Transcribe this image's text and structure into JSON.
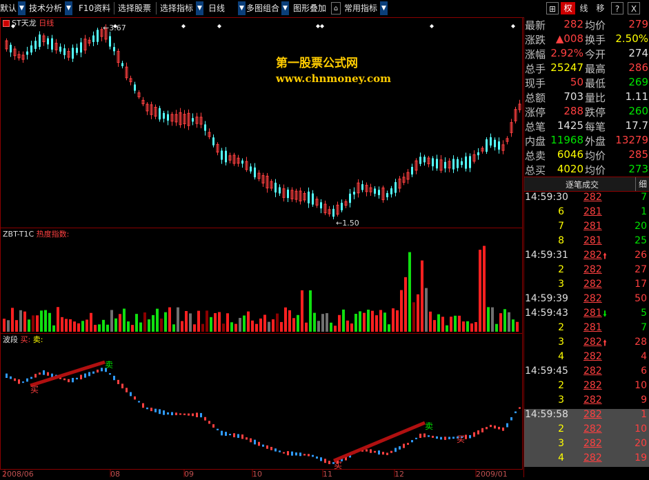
{
  "toolbar": {
    "items": [
      {
        "label": "默认",
        "dropdown": true
      },
      {
        "label": "技术分析",
        "dropdown": true
      },
      {
        "label": "F10资料",
        "dropdown": false
      },
      {
        "label": "选择股票",
        "dropdown": false
      },
      {
        "label": "选择指标",
        "dropdown": true
      },
      {
        "label": "日线",
        "dropdown": true
      },
      {
        "label": "多图组合",
        "dropdown": true
      },
      {
        "label": "图形叠加",
        "dropdown": false
      },
      {
        "label": "常用指标",
        "dropdown": true
      }
    ],
    "right_icon_plus": "⊞",
    "tabs": [
      "权",
      "线",
      "移",
      "?",
      "X"
    ],
    "active_tab": "权"
  },
  "main_chart": {
    "stock_name": "ST天龙",
    "period": "日线",
    "high_label": "3.67",
    "low_label": "1.50",
    "watermark_title": "第一股票公式网",
    "watermark_url": "www.chnmoney.com"
  },
  "indicator_panel": {
    "name": "ZBT-T1C",
    "label": "热度指数:"
  },
  "wave_panel": {
    "name": "波段",
    "buy": "买:",
    "sell": "卖:",
    "marker_buy": "买",
    "marker_sell": "卖"
  },
  "x_axis": {
    "labels": [
      "2008/06",
      "08",
      "09",
      "10",
      "11",
      "12",
      "2009/01"
    ]
  },
  "quote": {
    "rows": [
      {
        "l1": "最新",
        "v1": "282",
        "c1": "red",
        "l2": "均价",
        "v2": "279",
        "c2": "red"
      },
      {
        "l1": "涨跌",
        "v1": "▲008",
        "c1": "red",
        "l2": "换手",
        "v2": "2.50%",
        "c2": "yellow"
      },
      {
        "l1": "涨幅",
        "v1": "2.92%",
        "c1": "red",
        "l2": "今开",
        "v2": "274",
        "c2": "white"
      },
      {
        "l1": "总手",
        "v1": "25247",
        "c1": "yellow",
        "l2": "最高",
        "v2": "286",
        "c2": "red"
      },
      {
        "l1": "现手",
        "v1": "50",
        "c1": "red",
        "l2": "最低",
        "v2": "269",
        "c2": "green"
      },
      {
        "l1": "总额",
        "v1": "703",
        "c1": "white",
        "l2": "量比",
        "v2": "1.11",
        "c2": "white"
      },
      {
        "l1": "涨停",
        "v1": "288",
        "c1": "red",
        "l2": "跌停",
        "v2": "260",
        "c2": "green"
      },
      {
        "l1": "总笔",
        "v1": "1425",
        "c1": "white",
        "l2": "每笔",
        "v2": "17.7",
        "c2": "white"
      },
      {
        "l1": "内盘",
        "v1": "11968",
        "c1": "green",
        "l2": "外盘",
        "v2": "13279",
        "c2": "red"
      },
      {
        "l1": "总卖",
        "v1": "6046",
        "c1": "yellow",
        "l2": "均价",
        "v2": "285",
        "c2": "red"
      },
      {
        "l1": "总买",
        "v1": "4020",
        "c1": "yellow",
        "l2": "均价",
        "v2": "273",
        "c2": "green"
      }
    ],
    "ticks_title": "逐笔成交",
    "ticks_detail": "细"
  },
  "ticks": [
    {
      "time": "14:59:30",
      "price": "282",
      "arrow": "",
      "vol": "7",
      "vcolor": "green",
      "hl": false
    },
    {
      "time": "",
      "cnt": "6",
      "price": "281",
      "arrow": "",
      "vol": "1",
      "vcolor": "green",
      "hl": false
    },
    {
      "time": "",
      "cnt": "7",
      "price": "281",
      "arrow": "",
      "vol": "20",
      "vcolor": "green",
      "hl": false
    },
    {
      "time": "",
      "cnt": "8",
      "price": "281",
      "arrow": "",
      "vol": "25",
      "vcolor": "green",
      "hl": false
    },
    {
      "time": "14:59:31",
      "price": "282",
      "arrow": "up",
      "vol": "26",
      "vcolor": "red",
      "hl": false
    },
    {
      "time": "",
      "cnt": "2",
      "price": "282",
      "arrow": "",
      "vol": "27",
      "vcolor": "red",
      "hl": false
    },
    {
      "time": "",
      "cnt": "3",
      "price": "282",
      "arrow": "",
      "vol": "17",
      "vcolor": "red",
      "hl": false
    },
    {
      "time": "14:59:39",
      "price": "282",
      "arrow": "",
      "vol": "50",
      "vcolor": "red",
      "hl": false
    },
    {
      "time": "14:59:43",
      "price": "281",
      "arrow": "down",
      "vol": "5",
      "vcolor": "green",
      "hl": false
    },
    {
      "time": "",
      "cnt": "2",
      "price": "281",
      "arrow": "",
      "vol": "7",
      "vcolor": "green",
      "hl": false
    },
    {
      "time": "",
      "cnt": "3",
      "price": "282",
      "arrow": "up",
      "vol": "28",
      "vcolor": "red",
      "hl": false
    },
    {
      "time": "",
      "cnt": "4",
      "price": "282",
      "arrow": "",
      "vol": "4",
      "vcolor": "red",
      "hl": false
    },
    {
      "time": "14:59:45",
      "price": "282",
      "arrow": "",
      "vol": "6",
      "vcolor": "red",
      "hl": false
    },
    {
      "time": "",
      "cnt": "2",
      "price": "282",
      "arrow": "",
      "vol": "10",
      "vcolor": "red",
      "hl": false
    },
    {
      "time": "",
      "cnt": "3",
      "price": "282",
      "arrow": "",
      "vol": "9",
      "vcolor": "red",
      "hl": false
    },
    {
      "time": "14:59:58",
      "price": "282",
      "arrow": "",
      "vol": "1",
      "vcolor": "red",
      "hl": true
    },
    {
      "time": "",
      "cnt": "2",
      "price": "282",
      "arrow": "",
      "vol": "10",
      "vcolor": "red",
      "hl": true
    },
    {
      "time": "",
      "cnt": "3",
      "price": "282",
      "arrow": "",
      "vol": "20",
      "vcolor": "red",
      "hl": true
    },
    {
      "time": "",
      "cnt": "4",
      "price": "282",
      "arrow": "",
      "vol": "19",
      "vcolor": "red",
      "hl": true
    }
  ],
  "colors": {
    "up": "#ff4040",
    "down": "#54ffff",
    "panel_border": "#8b0000",
    "watermark": "#ffcc00"
  }
}
